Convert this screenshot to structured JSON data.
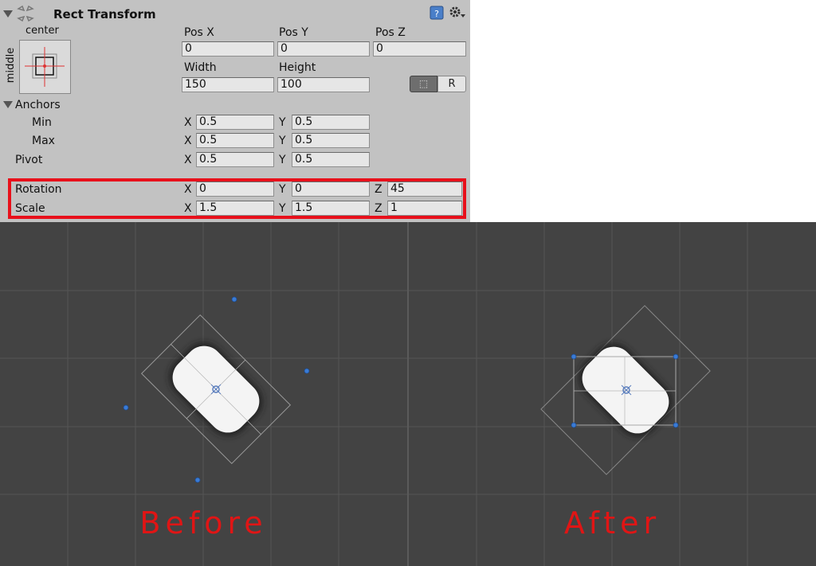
{
  "header": {
    "title": "Rect Transform",
    "icons": [
      "rect-transform-icon",
      "help-book-icon",
      "gear-icon"
    ]
  },
  "anchor_preset": {
    "top_label": "center",
    "side_label": "middle"
  },
  "position": {
    "pos_x_label": "Pos X",
    "pos_y_label": "Pos Y",
    "pos_z_label": "Pos Z",
    "pos_x": "0",
    "pos_y": "0",
    "pos_z": "0"
  },
  "size": {
    "width_label": "Width",
    "height_label": "Height",
    "width": "150",
    "height": "100"
  },
  "buttons": {
    "blueprint_label": "⬚",
    "raw_label": "R"
  },
  "anchors": {
    "label": "Anchors",
    "min_label": "Min",
    "max_label": "Max",
    "min_x": "0.5",
    "min_y": "0.5",
    "max_x": "0.5",
    "max_y": "0.5"
  },
  "pivot": {
    "label": "Pivot",
    "x": "0.5",
    "y": "0.5"
  },
  "rotation": {
    "label": "Rotation",
    "x": "0",
    "y": "0",
    "z": "45"
  },
  "scale": {
    "label": "Scale",
    "x": "1.5",
    "y": "1.5",
    "z": "1"
  },
  "axes": {
    "x": "X",
    "y": "Y",
    "z": "Z"
  },
  "captions": {
    "before": "Before",
    "after": "After"
  },
  "colors": {
    "highlight": "#e8101b",
    "caption": "#e01515",
    "scene_bg": "#434343",
    "handle": "#3a7bd5"
  }
}
